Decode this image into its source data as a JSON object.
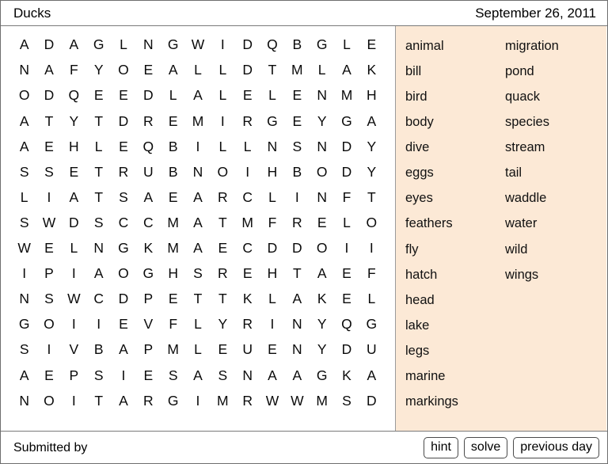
{
  "header": {
    "title": "Ducks",
    "date": "September 26, 2011"
  },
  "grid": {
    "rows": 15,
    "cols": 15,
    "letters": [
      [
        "A",
        "D",
        "A",
        "G",
        "L",
        "N",
        "G",
        "W",
        "I",
        "D",
        "Q",
        "B",
        "G",
        "L",
        "E"
      ],
      [
        "N",
        "A",
        "F",
        "Y",
        "O",
        "E",
        "A",
        "L",
        "L",
        "D",
        "T",
        "M",
        "L",
        "A",
        "K"
      ],
      [
        "O",
        "D",
        "Q",
        "E",
        "E",
        "D",
        "L",
        "A",
        "L",
        "E",
        "L",
        "E",
        "N",
        "M",
        "H"
      ],
      [
        "A",
        "T",
        "Y",
        "T",
        "D",
        "R",
        "E",
        "M",
        "I",
        "R",
        "G",
        "E",
        "Y",
        "G",
        "A"
      ],
      [
        "A",
        "E",
        "H",
        "L",
        "E",
        "Q",
        "B",
        "I",
        "L",
        "L",
        "N",
        "S",
        "N",
        "D",
        "Y"
      ],
      [
        "S",
        "S",
        "E",
        "T",
        "R",
        "U",
        "B",
        "N",
        "O",
        "I",
        "H",
        "B",
        "O",
        "D",
        "Y"
      ],
      [
        "L",
        "I",
        "A",
        "T",
        "S",
        "A",
        "E",
        "A",
        "R",
        "C",
        "L",
        "I",
        "N",
        "F",
        "T"
      ],
      [
        "S",
        "W",
        "D",
        "S",
        "C",
        "C",
        "M",
        "A",
        "T",
        "M",
        "F",
        "R",
        "E",
        "L",
        "O"
      ],
      [
        "W",
        "E",
        "L",
        "N",
        "G",
        "K",
        "M",
        "A",
        "E",
        "C",
        "D",
        "D",
        "O",
        "I",
        "I"
      ],
      [
        "I",
        "P",
        "I",
        "A",
        "O",
        "G",
        "H",
        "S",
        "R",
        "E",
        "H",
        "T",
        "A",
        "E",
        "F"
      ],
      [
        "N",
        "S",
        "W",
        "C",
        "D",
        "P",
        "E",
        "T",
        "T",
        "K",
        "L",
        "A",
        "K",
        "E",
        "L"
      ],
      [
        "G",
        "O",
        "I",
        "I",
        "E",
        "V",
        "F",
        "L",
        "Y",
        "R",
        "I",
        "N",
        "Y",
        "Q",
        "G"
      ],
      [
        "S",
        "I",
        "V",
        "B",
        "A",
        "P",
        "M",
        "L",
        "E",
        "U",
        "E",
        "N",
        "Y",
        "D",
        "U"
      ],
      [
        "A",
        "E",
        "P",
        "S",
        "I",
        "E",
        "S",
        "A",
        "S",
        "N",
        "A",
        "A",
        "G",
        "K",
        "A"
      ],
      [
        "N",
        "O",
        "I",
        "T",
        "A",
        "R",
        "G",
        "I",
        "M",
        "R",
        "W",
        "W",
        "M",
        "S",
        "D"
      ]
    ]
  },
  "word_list": {
    "column_1": [
      "animal",
      "bill",
      "bird",
      "body",
      "dive",
      "eggs",
      "eyes",
      "feathers",
      "fly",
      "hatch",
      "head",
      "lake",
      "legs",
      "marine",
      "markings"
    ],
    "column_2": [
      "migration",
      "pond",
      "quack",
      "species",
      "stream",
      "tail",
      "waddle",
      "water",
      "wild",
      "wings"
    ]
  },
  "footer": {
    "submitted_by_label": "Submitted by",
    "buttons": [
      {
        "name": "hint",
        "label": "hint"
      },
      {
        "name": "solve",
        "label": "solve"
      },
      {
        "name": "previous-day",
        "label": "previous day"
      }
    ]
  },
  "colors": {
    "word_panel_background": "#fce9d6",
    "page_background": "#ffffff",
    "text": "#000000",
    "border": "#6e6e6e"
  }
}
